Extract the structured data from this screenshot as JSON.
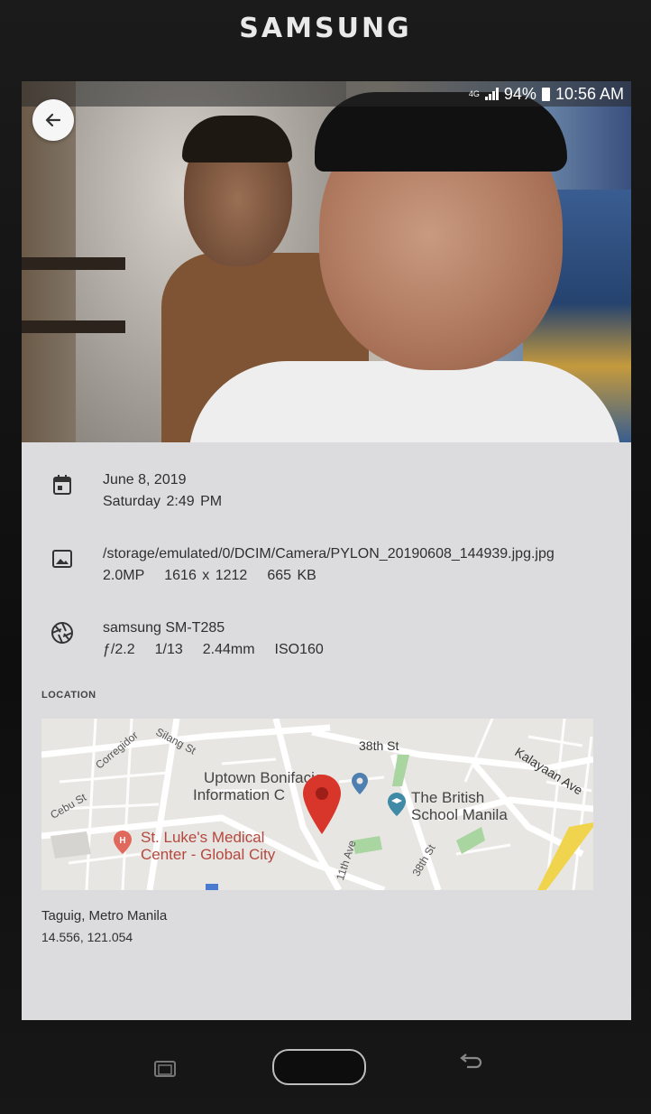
{
  "device": {
    "brand": "SAMSUNG"
  },
  "status_bar": {
    "network": "4G",
    "battery": "94%",
    "time": "10:56 AM"
  },
  "details": {
    "date": {
      "icon": "calendar-icon",
      "line1": "June 8, 2019",
      "line2": "Saturday 2:49 PM"
    },
    "file": {
      "icon": "image-icon",
      "path": "/storage/emulated/0/DCIM/Camera/PYLON_20190608_144939.jpg.jpg",
      "megapixels": "2.0MP",
      "resolution": "1616 x 1212",
      "size": "665 KB"
    },
    "camera": {
      "icon": "shutter-icon",
      "model": "samsung SM-T285",
      "aperture": "ƒ/2.2",
      "exposure": "1/13",
      "focal_length": "2.44mm",
      "iso": "ISO160"
    }
  },
  "location": {
    "header": "LOCATION",
    "place": "Taguig, Metro Manila",
    "coordinates": "14.556, 121.054",
    "map_labels": {
      "street_38th": "38th St",
      "kalayaan": "Kalayaan Ave",
      "corregidor": "Corregidor",
      "silang": "Silang St",
      "cebu": "Cebu St",
      "eleventh": "11th Ave",
      "street_38th_b": "38th St",
      "uptown_1": "Uptown Bonifacio",
      "uptown_2": "Information C",
      "british_1": "The British",
      "british_2": "School Manila",
      "stlukes_1": "St. Luke's Medical",
      "stlukes_2": "Center - Global City"
    }
  },
  "colors": {
    "pin": "#d9362b",
    "accent_red": "#b4483e",
    "map_green": "#a8d5a0"
  }
}
